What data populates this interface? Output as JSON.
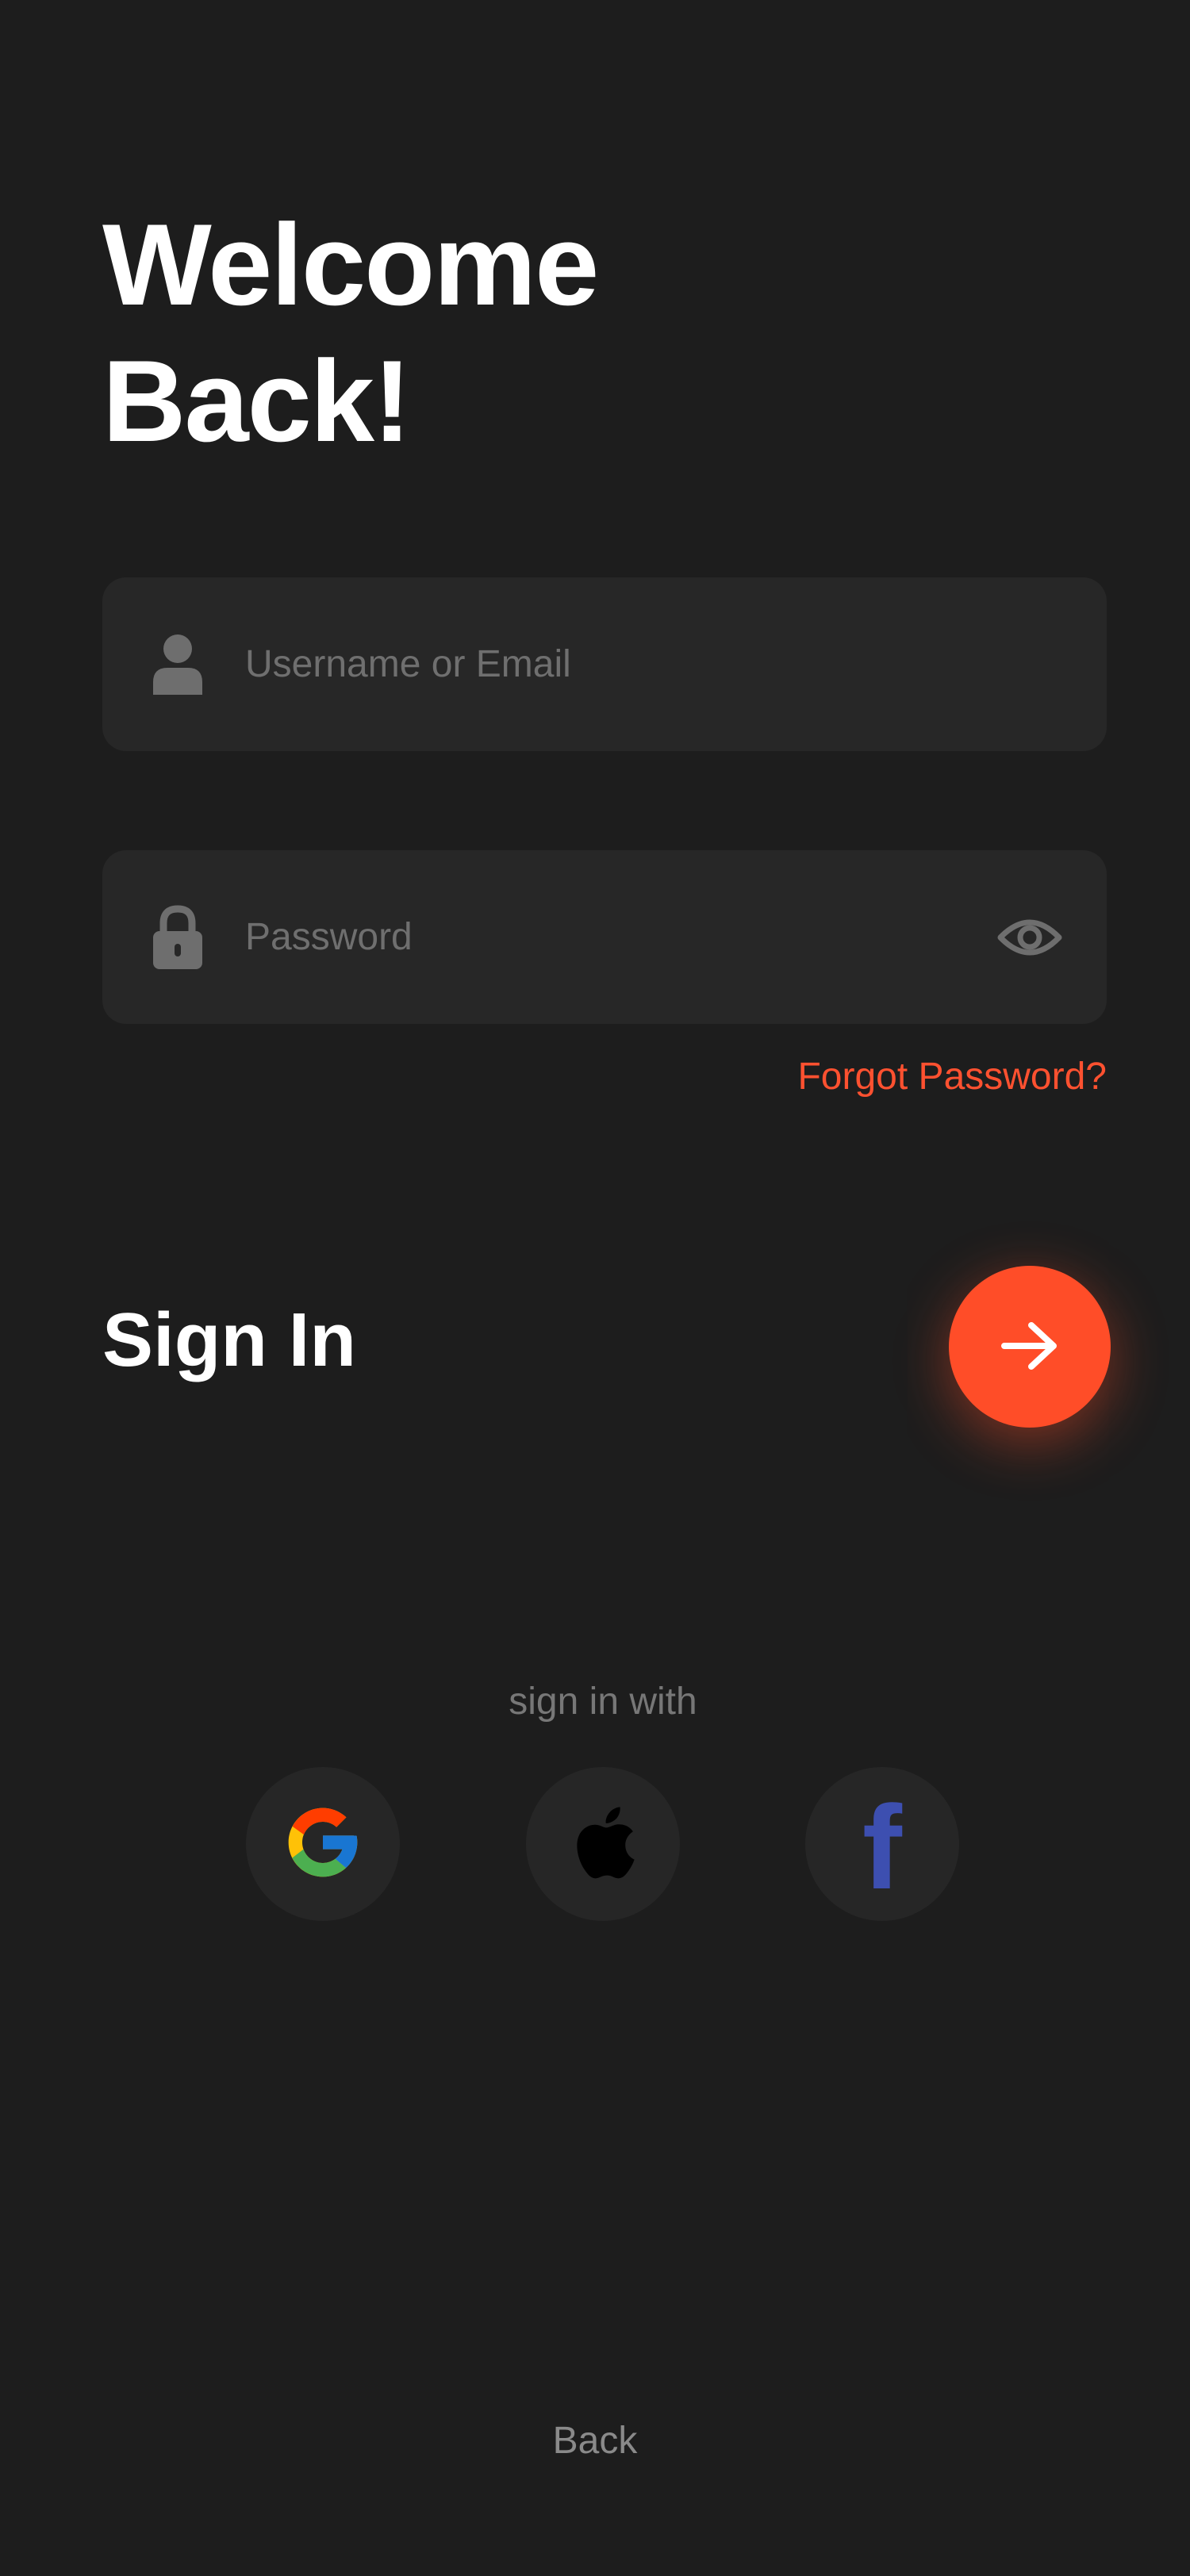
{
  "header": {
    "title_line1": "Welcome",
    "title_line2": "Back!"
  },
  "form": {
    "username": {
      "placeholder": "Username or Email",
      "value": "",
      "icon": "user-icon"
    },
    "password": {
      "placeholder": "Password",
      "value": "",
      "icon": "lock-icon",
      "toggle_icon": "eye-icon"
    },
    "forgot_password_label": "Forgot Password?",
    "signin_label": "Sign In",
    "signin_button_icon": "arrow-right-icon"
  },
  "social": {
    "label": "sign in with",
    "providers": [
      {
        "name": "Google",
        "icon": "google-icon"
      },
      {
        "name": "Apple",
        "icon": "apple-icon"
      },
      {
        "name": "Facebook",
        "icon": "facebook-icon",
        "glyph": "f"
      }
    ]
  },
  "footer": {
    "back_label": "Back"
  },
  "colors": {
    "background": "#1d1d1d",
    "field_bg": "#272727",
    "accent": "#ff4d28",
    "link": "#ff5130",
    "muted_text": "#6f6f6f",
    "icon_gray": "#6e6e6e",
    "facebook_blue": "#3d4fb0"
  }
}
